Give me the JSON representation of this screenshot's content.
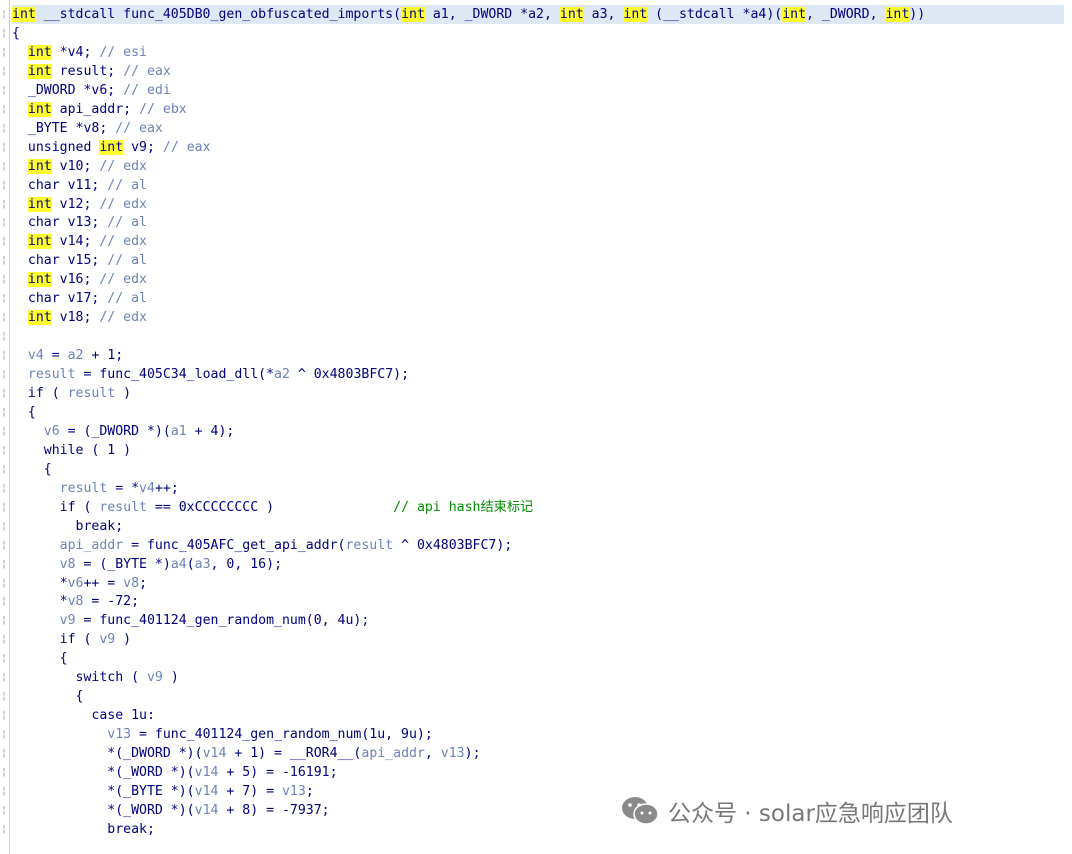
{
  "code": {
    "lines": [
      [
        {
          "t": "kw",
          "v": "int"
        },
        {
          "t": "tx",
          "v": " __stdcall func_405DB0_gen_obfuscated_imports("
        },
        {
          "t": "kw",
          "v": "int"
        },
        {
          "t": "tx",
          "v": " a1, _DWORD *a2, "
        },
        {
          "t": "kw",
          "v": "int"
        },
        {
          "t": "tx",
          "v": " a3, "
        },
        {
          "t": "kw",
          "v": "int"
        },
        {
          "t": "tx",
          "v": " (__stdcall *a4)("
        },
        {
          "t": "kw",
          "v": "int"
        },
        {
          "t": "tx",
          "v": ", _DWORD, "
        },
        {
          "t": "kw",
          "v": "int"
        },
        {
          "t": "tx",
          "v": "))"
        }
      ],
      [
        {
          "t": "tx",
          "v": "{"
        }
      ],
      [
        {
          "t": "tx",
          "v": "  "
        },
        {
          "t": "kw",
          "v": "int"
        },
        {
          "t": "tx",
          "v": " *v4; "
        },
        {
          "t": "cm",
          "v": "// esi"
        }
      ],
      [
        {
          "t": "tx",
          "v": "  "
        },
        {
          "t": "kw",
          "v": "int"
        },
        {
          "t": "tx",
          "v": " result; "
        },
        {
          "t": "cm",
          "v": "// eax"
        }
      ],
      [
        {
          "t": "tx",
          "v": "  _DWORD *v6; "
        },
        {
          "t": "cm",
          "v": "// edi"
        }
      ],
      [
        {
          "t": "tx",
          "v": "  "
        },
        {
          "t": "kw",
          "v": "int"
        },
        {
          "t": "tx",
          "v": " api_addr; "
        },
        {
          "t": "cm",
          "v": "// ebx"
        }
      ],
      [
        {
          "t": "tx",
          "v": "  _BYTE *v8; "
        },
        {
          "t": "cm",
          "v": "// eax"
        }
      ],
      [
        {
          "t": "tx",
          "v": "  unsigned "
        },
        {
          "t": "kw",
          "v": "int"
        },
        {
          "t": "tx",
          "v": " v9; "
        },
        {
          "t": "cm",
          "v": "// eax"
        }
      ],
      [
        {
          "t": "tx",
          "v": "  "
        },
        {
          "t": "kw",
          "v": "int"
        },
        {
          "t": "tx",
          "v": " v10; "
        },
        {
          "t": "cm",
          "v": "// edx"
        }
      ],
      [
        {
          "t": "tx",
          "v": "  char v11; "
        },
        {
          "t": "cm",
          "v": "// al"
        }
      ],
      [
        {
          "t": "tx",
          "v": "  "
        },
        {
          "t": "kw",
          "v": "int"
        },
        {
          "t": "tx",
          "v": " v12; "
        },
        {
          "t": "cm",
          "v": "// edx"
        }
      ],
      [
        {
          "t": "tx",
          "v": "  char v13; "
        },
        {
          "t": "cm",
          "v": "// al"
        }
      ],
      [
        {
          "t": "tx",
          "v": "  "
        },
        {
          "t": "kw",
          "v": "int"
        },
        {
          "t": "tx",
          "v": " v14; "
        },
        {
          "t": "cm",
          "v": "// edx"
        }
      ],
      [
        {
          "t": "tx",
          "v": "  char v15; "
        },
        {
          "t": "cm",
          "v": "// al"
        }
      ],
      [
        {
          "t": "tx",
          "v": "  "
        },
        {
          "t": "kw",
          "v": "int"
        },
        {
          "t": "tx",
          "v": " v16; "
        },
        {
          "t": "cm",
          "v": "// edx"
        }
      ],
      [
        {
          "t": "tx",
          "v": "  char v17; "
        },
        {
          "t": "cm",
          "v": "// al"
        }
      ],
      [
        {
          "t": "tx",
          "v": "  "
        },
        {
          "t": "kw",
          "v": "int"
        },
        {
          "t": "tx",
          "v": " v18; "
        },
        {
          "t": "cm",
          "v": "// edx"
        }
      ],
      [],
      [
        {
          "t": "tx",
          "v": "  "
        },
        {
          "t": "var",
          "v": "v4"
        },
        {
          "t": "tx",
          "v": " = "
        },
        {
          "t": "var",
          "v": "a2"
        },
        {
          "t": "tx",
          "v": " + 1;"
        }
      ],
      [
        {
          "t": "tx",
          "v": "  "
        },
        {
          "t": "var",
          "v": "result"
        },
        {
          "t": "tx",
          "v": " = func_405C34_load_dll(*"
        },
        {
          "t": "var",
          "v": "a2"
        },
        {
          "t": "tx",
          "v": " ^ 0x4803BFC7);"
        }
      ],
      [
        {
          "t": "tx",
          "v": "  if ( "
        },
        {
          "t": "var",
          "v": "result"
        },
        {
          "t": "tx",
          "v": " )"
        }
      ],
      [
        {
          "t": "tx",
          "v": "  {"
        }
      ],
      [
        {
          "t": "tx",
          "v": "    "
        },
        {
          "t": "var",
          "v": "v6"
        },
        {
          "t": "tx",
          "v": " = (_DWORD *)("
        },
        {
          "t": "var",
          "v": "a1"
        },
        {
          "t": "tx",
          "v": " + 4);"
        }
      ],
      [
        {
          "t": "tx",
          "v": "    while ( 1 )"
        }
      ],
      [
        {
          "t": "tx",
          "v": "    {"
        }
      ],
      [
        {
          "t": "tx",
          "v": "      "
        },
        {
          "t": "var",
          "v": "result"
        },
        {
          "t": "tx",
          "v": " = *"
        },
        {
          "t": "var",
          "v": "v4"
        },
        {
          "t": "tx",
          "v": "++;"
        }
      ],
      [
        {
          "t": "tx",
          "v": "      if ( "
        },
        {
          "t": "var",
          "v": "result"
        },
        {
          "t": "tx",
          "v": " == 0xCCCCCCCC )               "
        },
        {
          "t": "cmg",
          "v": "// api hash结束标记"
        }
      ],
      [
        {
          "t": "tx",
          "v": "        break;"
        }
      ],
      [
        {
          "t": "tx",
          "v": "      "
        },
        {
          "t": "var",
          "v": "api_addr"
        },
        {
          "t": "tx",
          "v": " = func_405AFC_get_api_addr("
        },
        {
          "t": "var",
          "v": "result"
        },
        {
          "t": "tx",
          "v": " ^ 0x4803BFC7);"
        }
      ],
      [
        {
          "t": "tx",
          "v": "      "
        },
        {
          "t": "var",
          "v": "v8"
        },
        {
          "t": "tx",
          "v": " = (_BYTE *)"
        },
        {
          "t": "var",
          "v": "a4"
        },
        {
          "t": "tx",
          "v": "("
        },
        {
          "t": "var",
          "v": "a3"
        },
        {
          "t": "tx",
          "v": ", 0, 16);"
        }
      ],
      [
        {
          "t": "tx",
          "v": "      *"
        },
        {
          "t": "var",
          "v": "v6"
        },
        {
          "t": "tx",
          "v": "++ = "
        },
        {
          "t": "var",
          "v": "v8"
        },
        {
          "t": "tx",
          "v": ";"
        }
      ],
      [
        {
          "t": "tx",
          "v": "      *"
        },
        {
          "t": "var",
          "v": "v8"
        },
        {
          "t": "tx",
          "v": " = -72;"
        }
      ],
      [
        {
          "t": "tx",
          "v": "      "
        },
        {
          "t": "var",
          "v": "v9"
        },
        {
          "t": "tx",
          "v": " = func_401124_gen_random_num(0, 4u);"
        }
      ],
      [
        {
          "t": "tx",
          "v": "      if ( "
        },
        {
          "t": "var",
          "v": "v9"
        },
        {
          "t": "tx",
          "v": " )"
        }
      ],
      [
        {
          "t": "tx",
          "v": "      {"
        }
      ],
      [
        {
          "t": "tx",
          "v": "        switch ( "
        },
        {
          "t": "var",
          "v": "v9"
        },
        {
          "t": "tx",
          "v": " )"
        }
      ],
      [
        {
          "t": "tx",
          "v": "        {"
        }
      ],
      [
        {
          "t": "tx",
          "v": "          case 1u:"
        }
      ],
      [
        {
          "t": "tx",
          "v": "            "
        },
        {
          "t": "var",
          "v": "v13"
        },
        {
          "t": "tx",
          "v": " = func_401124_gen_random_num(1u, 9u);"
        }
      ],
      [
        {
          "t": "tx",
          "v": "            *(_DWORD *)("
        },
        {
          "t": "var",
          "v": "v14"
        },
        {
          "t": "tx",
          "v": " + 1) = __ROR4__("
        },
        {
          "t": "var",
          "v": "api_addr"
        },
        {
          "t": "tx",
          "v": ", "
        },
        {
          "t": "var",
          "v": "v13"
        },
        {
          "t": "tx",
          "v": ");"
        }
      ],
      [
        {
          "t": "tx",
          "v": "            *(_WORD *)("
        },
        {
          "t": "var",
          "v": "v14"
        },
        {
          "t": "tx",
          "v": " + 5) = -16191;"
        }
      ],
      [
        {
          "t": "tx",
          "v": "            *(_BYTE *)("
        },
        {
          "t": "var",
          "v": "v14"
        },
        {
          "t": "tx",
          "v": " + 7) = "
        },
        {
          "t": "var",
          "v": "v13"
        },
        {
          "t": "tx",
          "v": ";"
        }
      ],
      [
        {
          "t": "tx",
          "v": "            *(_WORD *)("
        },
        {
          "t": "var",
          "v": "v14"
        },
        {
          "t": "tx",
          "v": " + 8) = -7937;"
        }
      ],
      [
        {
          "t": "tx",
          "v": "            break;"
        }
      ]
    ]
  },
  "watermark": {
    "text": "公众号 · solar应急响应团队",
    "icon": "wechat-icon"
  },
  "colors": {
    "keyword_highlight": "#ffff2e",
    "code_text": "#000080",
    "variable": "#6d83b7",
    "comment_green": "#009000",
    "current_line": "#dde8f4"
  }
}
